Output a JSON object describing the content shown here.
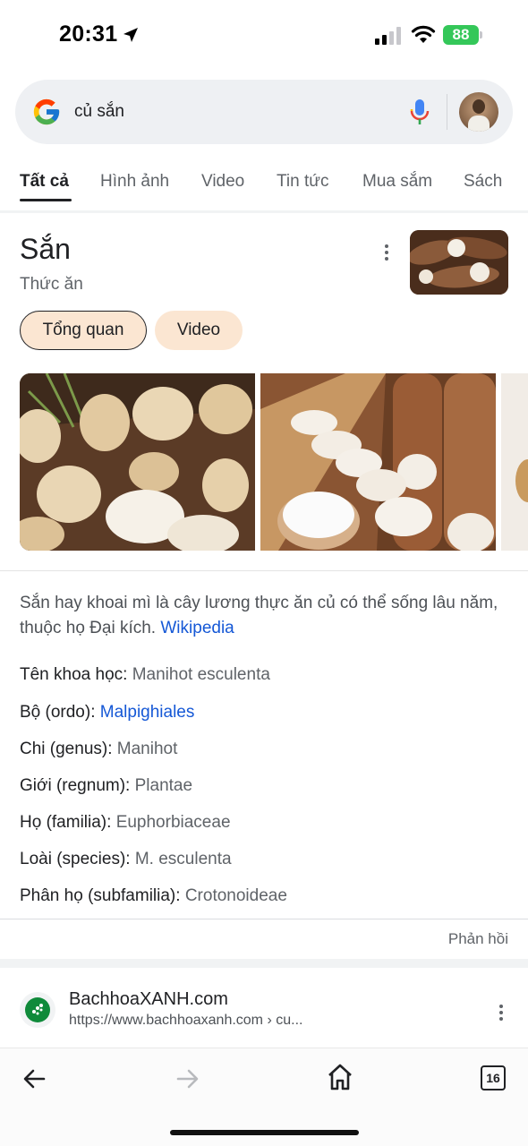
{
  "status_bar": {
    "time": "20:31",
    "battery": "88",
    "icons": [
      "location-arrow-icon",
      "cellular-signal-icon",
      "wifi-icon",
      "battery-icon"
    ]
  },
  "search": {
    "query": "củ sắn",
    "icons": [
      "google-logo-icon",
      "microphone-icon",
      "avatar"
    ]
  },
  "tabs": [
    {
      "label": "Tất cả",
      "active": true
    },
    {
      "label": "Hình ảnh"
    },
    {
      "label": "Video"
    },
    {
      "label": "Tin tức"
    },
    {
      "label": "Mua sắm"
    },
    {
      "label": "Sách"
    }
  ],
  "knowledge_panel": {
    "title": "Sắn",
    "subtitle": "Thức ăn",
    "chips": [
      {
        "label": "Tổng quan",
        "selected": true
      },
      {
        "label": "Video"
      }
    ],
    "description": "Sắn hay khoai mì là cây lương thực ăn củ có thể sống lâu năm, thuộc họ Đại kích.",
    "description_link": "Wikipedia",
    "facts": [
      {
        "label": "Tên khoa học:",
        "value": "Manihot esculenta",
        "is_link": false
      },
      {
        "label": "Bộ (ordo):",
        "value": "Malpighiales",
        "is_link": true
      },
      {
        "label": "Chi (genus):",
        "value": "Manihot",
        "is_link": false
      },
      {
        "label": "Giới (regnum):",
        "value": "Plantae",
        "is_link": false
      },
      {
        "label": "Họ (familia):",
        "value": "Euphorbiaceae",
        "is_link": false
      },
      {
        "label": "Loài (species):",
        "value": "M. esculenta",
        "is_link": false
      },
      {
        "label": "Phân họ (subfamilia):",
        "value": "Crotonoideae",
        "is_link": false
      }
    ],
    "feedback": "Phản hồi"
  },
  "result": {
    "site_name": "BachhoaXANH.com",
    "url": "https://www.bachhoaxanh.com › cu..."
  },
  "toolbar": {
    "tab_count": "16",
    "icons": [
      "back-arrow-icon",
      "forward-arrow-icon",
      "home-icon",
      "tabs-icon"
    ]
  },
  "colors": {
    "link": "#1558d6",
    "chip_bg": "#fbe6d2",
    "battery_green": "#34c759",
    "search_bg": "#eef0f3"
  }
}
